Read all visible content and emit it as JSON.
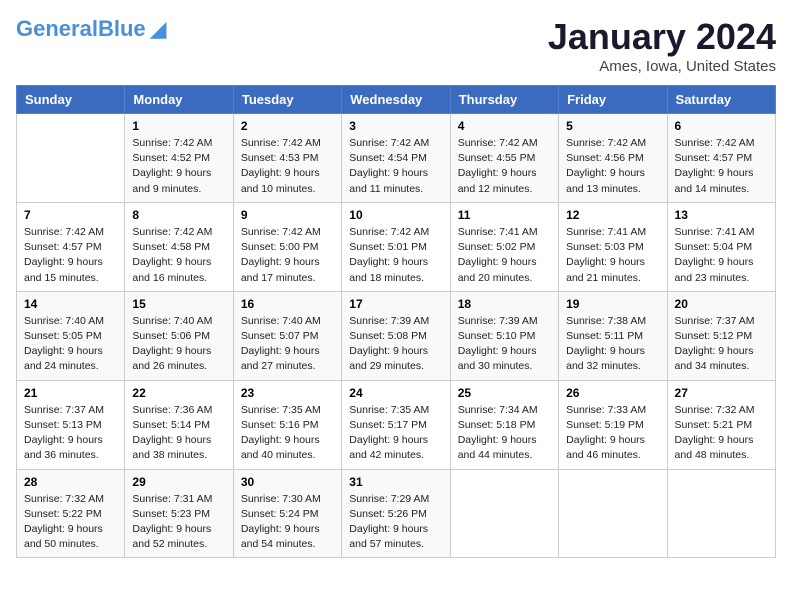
{
  "header": {
    "logo_general": "General",
    "logo_blue": "Blue",
    "month_title": "January 2024",
    "location": "Ames, Iowa, United States"
  },
  "days_of_week": [
    "Sunday",
    "Monday",
    "Tuesday",
    "Wednesday",
    "Thursday",
    "Friday",
    "Saturday"
  ],
  "weeks": [
    [
      {
        "num": "",
        "info": ""
      },
      {
        "num": "1",
        "info": "Sunrise: 7:42 AM\nSunset: 4:52 PM\nDaylight: 9 hours\nand 9 minutes."
      },
      {
        "num": "2",
        "info": "Sunrise: 7:42 AM\nSunset: 4:53 PM\nDaylight: 9 hours\nand 10 minutes."
      },
      {
        "num": "3",
        "info": "Sunrise: 7:42 AM\nSunset: 4:54 PM\nDaylight: 9 hours\nand 11 minutes."
      },
      {
        "num": "4",
        "info": "Sunrise: 7:42 AM\nSunset: 4:55 PM\nDaylight: 9 hours\nand 12 minutes."
      },
      {
        "num": "5",
        "info": "Sunrise: 7:42 AM\nSunset: 4:56 PM\nDaylight: 9 hours\nand 13 minutes."
      },
      {
        "num": "6",
        "info": "Sunrise: 7:42 AM\nSunset: 4:57 PM\nDaylight: 9 hours\nand 14 minutes."
      }
    ],
    [
      {
        "num": "7",
        "info": "Sunrise: 7:42 AM\nSunset: 4:57 PM\nDaylight: 9 hours\nand 15 minutes."
      },
      {
        "num": "8",
        "info": "Sunrise: 7:42 AM\nSunset: 4:58 PM\nDaylight: 9 hours\nand 16 minutes."
      },
      {
        "num": "9",
        "info": "Sunrise: 7:42 AM\nSunset: 5:00 PM\nDaylight: 9 hours\nand 17 minutes."
      },
      {
        "num": "10",
        "info": "Sunrise: 7:42 AM\nSunset: 5:01 PM\nDaylight: 9 hours\nand 18 minutes."
      },
      {
        "num": "11",
        "info": "Sunrise: 7:41 AM\nSunset: 5:02 PM\nDaylight: 9 hours\nand 20 minutes."
      },
      {
        "num": "12",
        "info": "Sunrise: 7:41 AM\nSunset: 5:03 PM\nDaylight: 9 hours\nand 21 minutes."
      },
      {
        "num": "13",
        "info": "Sunrise: 7:41 AM\nSunset: 5:04 PM\nDaylight: 9 hours\nand 23 minutes."
      }
    ],
    [
      {
        "num": "14",
        "info": "Sunrise: 7:40 AM\nSunset: 5:05 PM\nDaylight: 9 hours\nand 24 minutes."
      },
      {
        "num": "15",
        "info": "Sunrise: 7:40 AM\nSunset: 5:06 PM\nDaylight: 9 hours\nand 26 minutes."
      },
      {
        "num": "16",
        "info": "Sunrise: 7:40 AM\nSunset: 5:07 PM\nDaylight: 9 hours\nand 27 minutes."
      },
      {
        "num": "17",
        "info": "Sunrise: 7:39 AM\nSunset: 5:08 PM\nDaylight: 9 hours\nand 29 minutes."
      },
      {
        "num": "18",
        "info": "Sunrise: 7:39 AM\nSunset: 5:10 PM\nDaylight: 9 hours\nand 30 minutes."
      },
      {
        "num": "19",
        "info": "Sunrise: 7:38 AM\nSunset: 5:11 PM\nDaylight: 9 hours\nand 32 minutes."
      },
      {
        "num": "20",
        "info": "Sunrise: 7:37 AM\nSunset: 5:12 PM\nDaylight: 9 hours\nand 34 minutes."
      }
    ],
    [
      {
        "num": "21",
        "info": "Sunrise: 7:37 AM\nSunset: 5:13 PM\nDaylight: 9 hours\nand 36 minutes."
      },
      {
        "num": "22",
        "info": "Sunrise: 7:36 AM\nSunset: 5:14 PM\nDaylight: 9 hours\nand 38 minutes."
      },
      {
        "num": "23",
        "info": "Sunrise: 7:35 AM\nSunset: 5:16 PM\nDaylight: 9 hours\nand 40 minutes."
      },
      {
        "num": "24",
        "info": "Sunrise: 7:35 AM\nSunset: 5:17 PM\nDaylight: 9 hours\nand 42 minutes."
      },
      {
        "num": "25",
        "info": "Sunrise: 7:34 AM\nSunset: 5:18 PM\nDaylight: 9 hours\nand 44 minutes."
      },
      {
        "num": "26",
        "info": "Sunrise: 7:33 AM\nSunset: 5:19 PM\nDaylight: 9 hours\nand 46 minutes."
      },
      {
        "num": "27",
        "info": "Sunrise: 7:32 AM\nSunset: 5:21 PM\nDaylight: 9 hours\nand 48 minutes."
      }
    ],
    [
      {
        "num": "28",
        "info": "Sunrise: 7:32 AM\nSunset: 5:22 PM\nDaylight: 9 hours\nand 50 minutes."
      },
      {
        "num": "29",
        "info": "Sunrise: 7:31 AM\nSunset: 5:23 PM\nDaylight: 9 hours\nand 52 minutes."
      },
      {
        "num": "30",
        "info": "Sunrise: 7:30 AM\nSunset: 5:24 PM\nDaylight: 9 hours\nand 54 minutes."
      },
      {
        "num": "31",
        "info": "Sunrise: 7:29 AM\nSunset: 5:26 PM\nDaylight: 9 hours\nand 57 minutes."
      },
      {
        "num": "",
        "info": ""
      },
      {
        "num": "",
        "info": ""
      },
      {
        "num": "",
        "info": ""
      }
    ]
  ]
}
